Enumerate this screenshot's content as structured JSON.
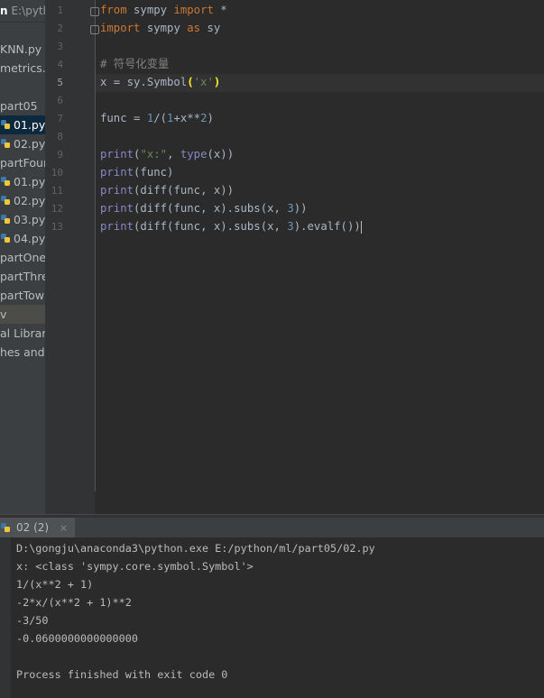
{
  "project_header": {
    "name": "n",
    "path": "E:\\python"
  },
  "sidebar": {
    "items": [
      {
        "label": "KNN.py",
        "kind": "text"
      },
      {
        "label": "metrics.py",
        "kind": "text"
      },
      {
        "label": "part05",
        "kind": "text"
      },
      {
        "label": "01.py",
        "kind": "file",
        "state": "selected"
      },
      {
        "label": "02.py",
        "kind": "file"
      },
      {
        "label": "partFour",
        "kind": "text"
      },
      {
        "label": "01.py",
        "kind": "file"
      },
      {
        "label": "02.py",
        "kind": "file"
      },
      {
        "label": "03.py",
        "kind": "file"
      },
      {
        "label": "04.py",
        "kind": "file"
      },
      {
        "label": "partOne",
        "kind": "text"
      },
      {
        "label": "partThree",
        "kind": "text"
      },
      {
        "label": "partTow",
        "kind": "text"
      },
      {
        "label": "v",
        "kind": "text",
        "state": "highlighted"
      },
      {
        "label": "al Libraries",
        "kind": "text"
      },
      {
        "label": "hes and Consoles",
        "kind": "text"
      }
    ]
  },
  "editor": {
    "line_numbers": [
      "1",
      "2",
      "3",
      "4",
      "5",
      "6",
      "7",
      "8",
      "9",
      "10",
      "11",
      "12",
      "13"
    ],
    "current_line": "5",
    "lines": [
      {
        "n": "1",
        "parts": [
          [
            "kw",
            "from"
          ],
          [
            "t",
            " sympy "
          ],
          [
            "kw",
            "import"
          ],
          [
            "t",
            " *"
          ]
        ]
      },
      {
        "n": "2",
        "parts": [
          [
            "kw",
            "import"
          ],
          [
            "t",
            " sympy "
          ],
          [
            "kw",
            "as"
          ],
          [
            "t",
            " sy"
          ]
        ]
      },
      {
        "n": "3",
        "parts": []
      },
      {
        "n": "4",
        "parts": [
          [
            "cm",
            "# 符号化变量"
          ]
        ]
      },
      {
        "n": "5",
        "parts": [
          [
            "t",
            "x = sy.Symbol"
          ],
          [
            "pm",
            "("
          ],
          [
            "st",
            "'x'"
          ],
          [
            "pm",
            ")"
          ]
        ]
      },
      {
        "n": "6",
        "parts": []
      },
      {
        "n": "7",
        "parts": [
          [
            "t",
            "func = "
          ],
          [
            "nm",
            "1"
          ],
          [
            "t",
            "/("
          ],
          [
            "nm",
            "1"
          ],
          [
            "t",
            "+x**"
          ],
          [
            "nm",
            "2"
          ],
          [
            "t",
            ")"
          ]
        ]
      },
      {
        "n": "8",
        "parts": []
      },
      {
        "n": "9",
        "parts": [
          [
            "bi",
            "print"
          ],
          [
            "t",
            "("
          ],
          [
            "st",
            "\"x:\""
          ],
          [
            "t",
            ", "
          ],
          [
            "bi",
            "type"
          ],
          [
            "t",
            "(x))"
          ]
        ]
      },
      {
        "n": "10",
        "parts": [
          [
            "bi",
            "print"
          ],
          [
            "t",
            "(func)"
          ]
        ]
      },
      {
        "n": "11",
        "parts": [
          [
            "bi",
            "print"
          ],
          [
            "t",
            "(diff(func, x))"
          ]
        ]
      },
      {
        "n": "12",
        "parts": [
          [
            "bi",
            "print"
          ],
          [
            "t",
            "(diff(func, x).subs(x, "
          ],
          [
            "nm",
            "3"
          ],
          [
            "t",
            "))"
          ]
        ]
      },
      {
        "n": "13",
        "parts": [
          [
            "bi",
            "print"
          ],
          [
            "t",
            "(diff(func, x).subs(x, "
          ],
          [
            "nm",
            "3"
          ],
          [
            "t",
            ").evalf())"
          ]
        ]
      }
    ]
  },
  "run_panel": {
    "tab_label": "02 (2)",
    "close_symbol": "×",
    "output": [
      "D:\\gongju\\anaconda3\\python.exe E:/python/ml/part05/02.py",
      "x: <class 'sympy.core.symbol.Symbol'>",
      "1/(x**2 + 1)",
      "-2*x/(x**2 + 1)**2",
      "-3/50",
      "-0.0600000000000000",
      "",
      "Process finished with exit code 0"
    ]
  },
  "colors": {
    "keyword": "#cc7832",
    "string": "#6a8759",
    "number": "#6897bb",
    "comment": "#808080",
    "builtin": "#8888c6",
    "text": "#a9b7c6",
    "selection": "#0d293e",
    "background": "#2b2b2b"
  },
  "icons": {
    "file_icon": "python-file-icon",
    "fold_icon": "fold-marker-icon"
  }
}
